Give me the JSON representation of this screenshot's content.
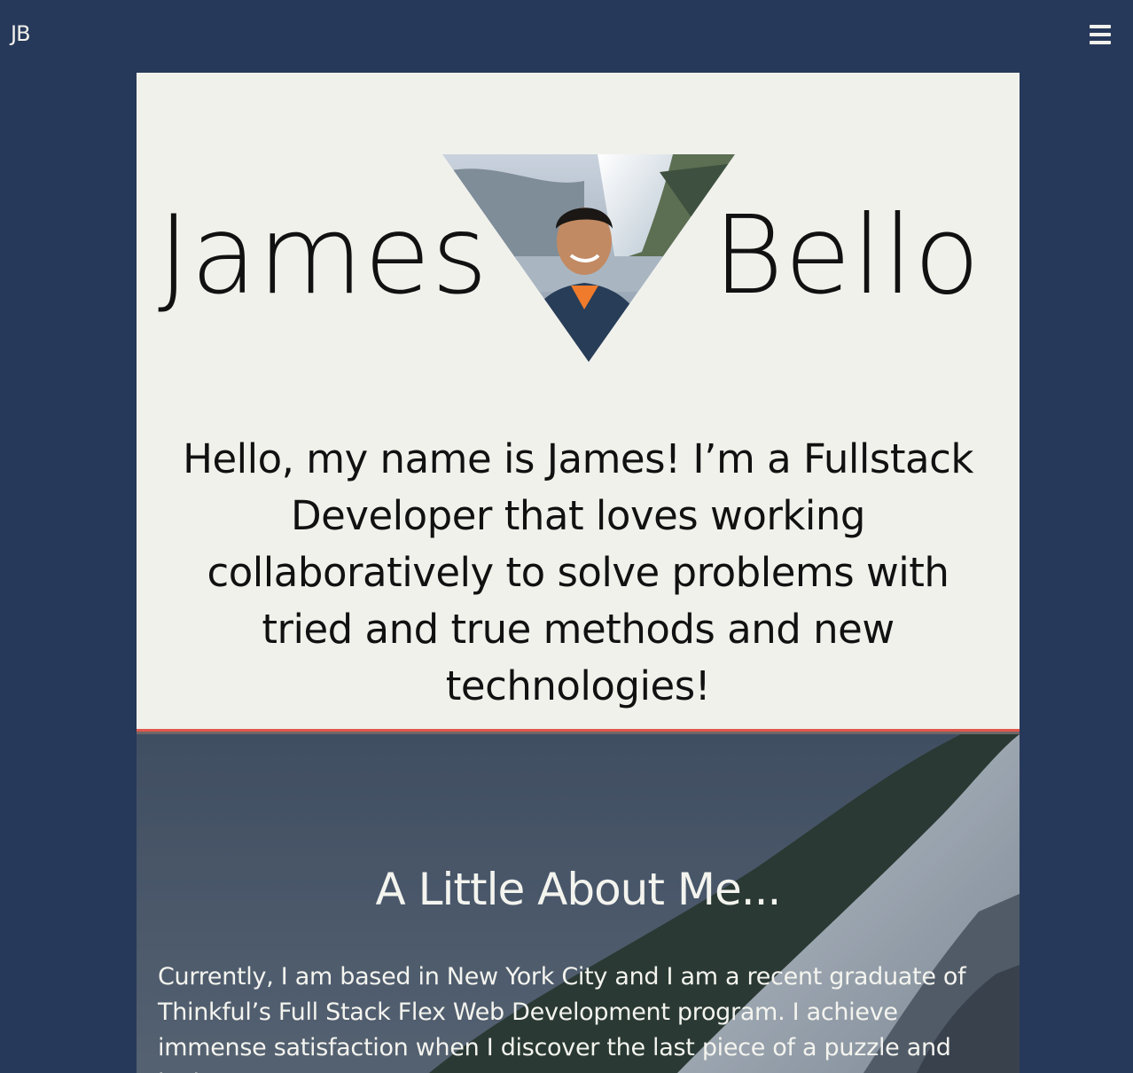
{
  "header": {
    "logo": "JB",
    "menu_icon": "hamburger-menu-icon"
  },
  "hero": {
    "first_name": "James",
    "last_name": "Bello",
    "intro": "Hello, my name is James! I’m a Fullstack Developer that loves working collaboratively to solve problems with tried and true methods and new technologies!"
  },
  "about": {
    "title": "A Little About Me...",
    "text": "Currently, I am based in New York City and I am a recent graduate of Thinkful’s Full Stack Flex Web Development program. I achieve immense satisfaction when I discover the last piece of a puzzle and look"
  },
  "colors": {
    "background": "#27395a",
    "hero_bg": "#f1f1ec",
    "accent": "#e2574c",
    "text_dark": "#111111",
    "text_light": "#f4f4ef"
  }
}
